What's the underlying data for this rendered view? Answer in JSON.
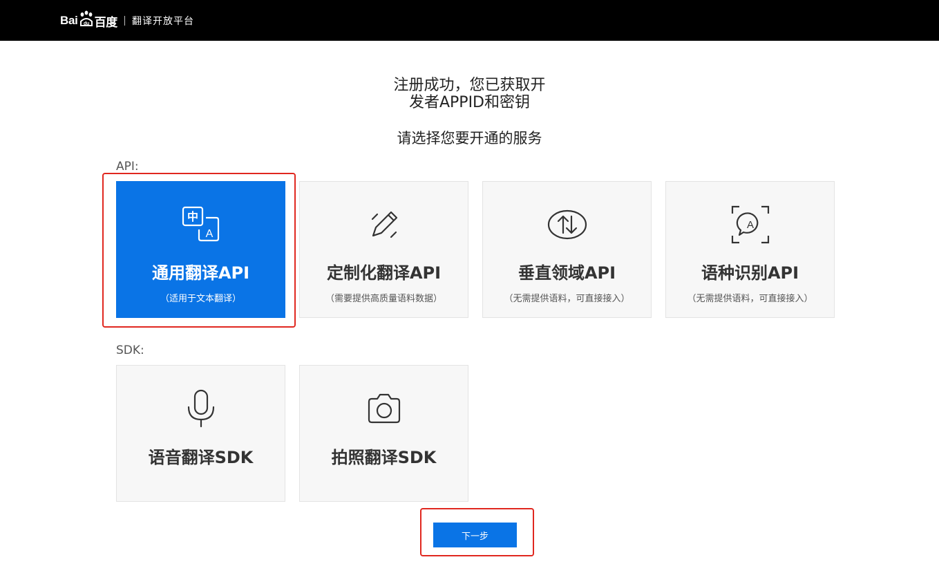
{
  "header": {
    "logo_text_left": "Bai",
    "logo_text_right": "百度",
    "platform_name": "翻译开放平台"
  },
  "headline": {
    "line1": "注册成功，您已获取开",
    "line2": "发者APPID和密钥",
    "prompt": "请选择您要开通的服务"
  },
  "sections": {
    "api_label": "API:",
    "sdk_label": "SDK:"
  },
  "api_cards": [
    {
      "title": "通用翻译API",
      "desc": "（适用于文本翻译）",
      "icon": "translate-icon",
      "selected": true
    },
    {
      "title": "定制化翻译API",
      "desc": "（需要提供高质量语料数据）",
      "icon": "pencil-edit-icon",
      "selected": false
    },
    {
      "title": "垂直领域API",
      "desc": "（无需提供语料，可直接接入）",
      "icon": "up-down-arrows-icon",
      "selected": false
    },
    {
      "title": "语种识别API",
      "desc": "（无需提供语料，可直接接入）",
      "icon": "language-detect-icon",
      "selected": false
    }
  ],
  "sdk_cards": [
    {
      "title": "语音翻译SDK",
      "icon": "microphone-icon"
    },
    {
      "title": "拍照翻译SDK",
      "icon": "camera-icon"
    }
  ],
  "next_button": {
    "label": "下一步"
  },
  "colors": {
    "accent": "#0a74e6",
    "highlight": "#e0271f",
    "header_bg": "#000000"
  }
}
